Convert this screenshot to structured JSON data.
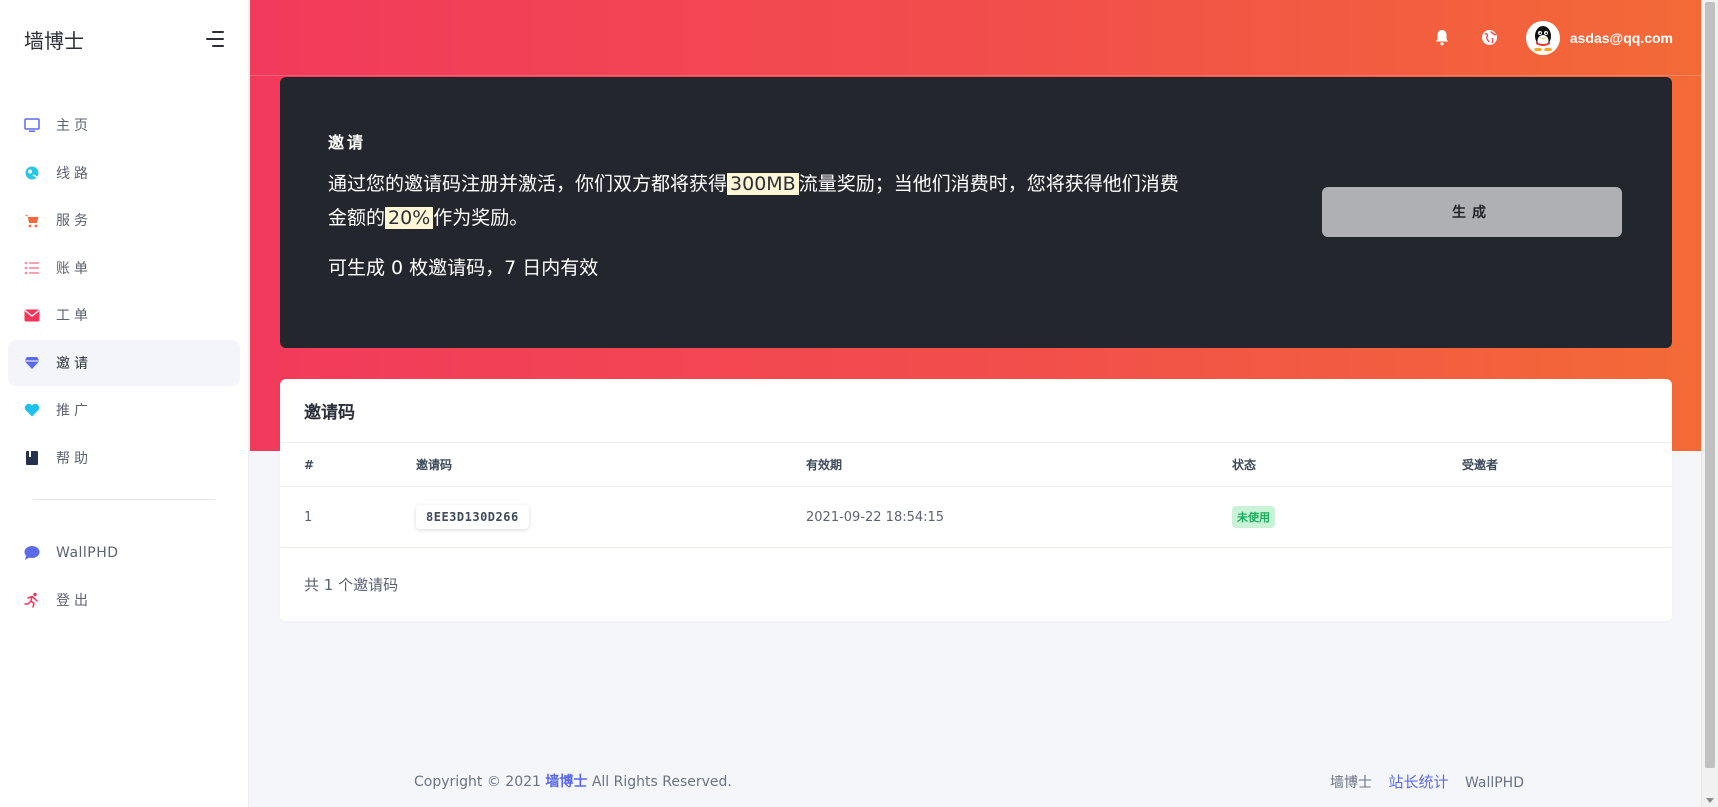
{
  "brand": "墙博士",
  "sidebar": {
    "items": [
      {
        "label": "主页",
        "icon": "monitor-icon"
      },
      {
        "label": "线路",
        "icon": "globe-icon"
      },
      {
        "label": "服务",
        "icon": "cart-icon"
      },
      {
        "label": "账单",
        "icon": "list-icon"
      },
      {
        "label": "工单",
        "icon": "mail-icon"
      },
      {
        "label": "邀请",
        "icon": "diamond-icon",
        "active": true
      },
      {
        "label": "推广",
        "icon": "heart-icon"
      },
      {
        "label": "帮助",
        "icon": "book-icon"
      }
    ],
    "extra": [
      {
        "label": "WallPHD",
        "icon": "chat-icon"
      },
      {
        "label": "登出",
        "icon": "running-icon"
      }
    ]
  },
  "topbar": {
    "user_email": "asdas@qq.com"
  },
  "invite": {
    "title": "邀请",
    "desc_part1": "通过您的邀请码注册并激活，你们双方都将获得",
    "traffic": "300MB",
    "desc_part2": "流量奖励；当他们消费时，您将获得他们消费金额的",
    "percent": "20%",
    "desc_part3": "作为奖励。",
    "count_text": "可生成 0 枚邀请码，7 日内有效",
    "generate_label": "生成"
  },
  "codes": {
    "title": "邀请码",
    "columns": [
      "#",
      "邀请码",
      "有效期",
      "状态",
      "受邀者"
    ],
    "rows": [
      {
        "index": "1",
        "code": "8EE3D130D266",
        "expires": "2021-09-22 18:54:15",
        "status": "未使用",
        "invitee": ""
      }
    ],
    "total": "共 1 个邀请码"
  },
  "footer": {
    "copyright_prefix": "Copyright © 2021",
    "brand_link": "墙博士",
    "copyright_suffix": "All Rights Reserved.",
    "right_links": [
      "墙博士",
      "站长统计",
      "WallPHD"
    ]
  },
  "colors": {
    "accent": "#5b6be8",
    "hero_start": "#f23a5c",
    "hero_end": "#f36a36",
    "card_dark": "#24262d",
    "status_green": "#1aae5a"
  }
}
